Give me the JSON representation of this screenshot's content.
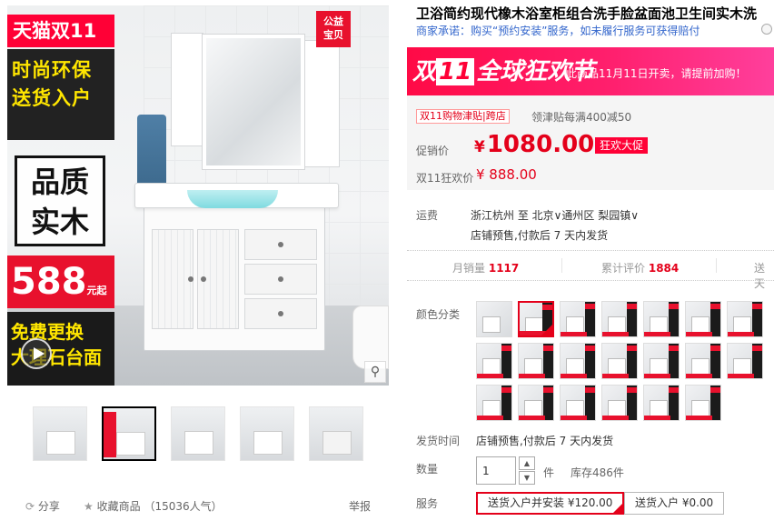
{
  "image": {
    "banner_tmall": "天猫双11",
    "slogan1_line1": "时尚环保",
    "slogan1_line2": "送货入户",
    "quality_line1": "品质",
    "quality_line2": "实木",
    "price_big": "588",
    "price_suffix": "元起",
    "slogan2_line1": "免费更换",
    "slogan2_line2": "大理石台面",
    "charity_line1": "公益",
    "charity_line2": "宝贝"
  },
  "actions": {
    "share": "分享",
    "favorite": "收藏商品",
    "favorite_count": "（15036人气）",
    "report": "举报"
  },
  "product": {
    "title": "卫浴简约现代橡木浴室柜组合洗手脸盆面池卫生间实木洗",
    "promise_prefix": "商家承诺：购买“预约安装”服务，如未履行服务可获得赔付"
  },
  "banner": {
    "logo_double": "双",
    "logo_eleven": "11",
    "logo_text": "全球狂欢节",
    "text": "此商品11月11日开卖，请提前加购！"
  },
  "pricing": {
    "allowance_badge": "双11购物津贴|跨店",
    "allowance_text": "领津贴每满400减50",
    "promo_label": "促销价",
    "currency": "¥",
    "promo_price": "1080.00",
    "promo_tag": "狂欢大促",
    "d11_label": "双11狂欢价",
    "d11_price": "¥ 888.00"
  },
  "shipping": {
    "label": "运费",
    "dest": "浙江杭州  至  北京∨通州区  梨园镇∨",
    "note": "店铺预售,付款后 7 天内发货"
  },
  "stats": {
    "monthly_label": "月销量",
    "monthly_value": "1117",
    "reviews_label": "累计评价",
    "reviews_value": "1884",
    "points_label": "送天"
  },
  "sku": {
    "label": "颜色分类"
  },
  "delivery": {
    "label": "发货时间",
    "value": "店铺预售,付款后 7 天内发货"
  },
  "quantity": {
    "label": "数量",
    "value": "1",
    "unit": "件",
    "stock": "库存486件"
  },
  "service": {
    "label": "服务",
    "options": [
      {
        "label": "送货入户并安装 ¥120.00"
      },
      {
        "label": "送货入户 ¥0.00"
      }
    ]
  },
  "colors": {
    "tmall_red": "#ff0036",
    "price_red": "#e4001a",
    "promise_blue": "#3366cc"
  }
}
